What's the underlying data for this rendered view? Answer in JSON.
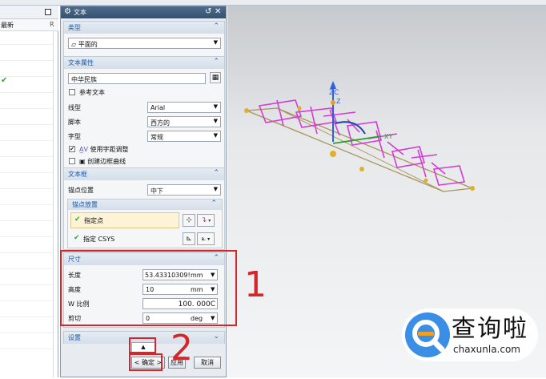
{
  "navigator": {
    "column_label": "最新",
    "column_r": "R"
  },
  "dialog": {
    "title": "文本",
    "type_section": {
      "header": "类型",
      "value": "平面的"
    },
    "text_props": {
      "header": "文本属性",
      "text_value": "中华民族",
      "ref_text_label": "参考文本",
      "line_type_label": "线型",
      "line_type_value": "Arial",
      "script_label": "脚本",
      "script_value": "西方的",
      "style_label": "字型",
      "style_value": "常规",
      "kerning_label": "使用字距调整",
      "kerning_checked": true,
      "border_label": "创建边框曲线",
      "border_checked": false
    },
    "text_frame": {
      "header": "文本框",
      "anchor_label": "锚点位置",
      "anchor_value": "中下",
      "anchor_placement_header": "锚点放置",
      "specify_point_label": "指定点",
      "specify_csys_label": "指定 CSYS"
    },
    "dimensions": {
      "header": "尺寸",
      "length_label": "长度",
      "length_value": "53.43310309!",
      "length_unit": "mm",
      "height_label": "高度",
      "height_value": "10",
      "height_unit": "mm",
      "wscale_label": "W 比例",
      "wscale_value": "100. 000C",
      "shear_label": "剪切",
      "shear_value": "0",
      "shear_unit": "deg"
    },
    "settings_header": "设置",
    "buttons": {
      "ok": "< 确定 >",
      "apply": "应用",
      "cancel": "取消"
    }
  },
  "annotations": {
    "step1": "1",
    "step2": "2"
  },
  "watermark": {
    "text": "查询啦",
    "sub": "chaxunla.com"
  },
  "colors": {
    "title_bar": "#3f5e80",
    "section_header_text": "#1e5aa8",
    "annotation": "#d6262b",
    "text_curve": "#d43bd6"
  }
}
